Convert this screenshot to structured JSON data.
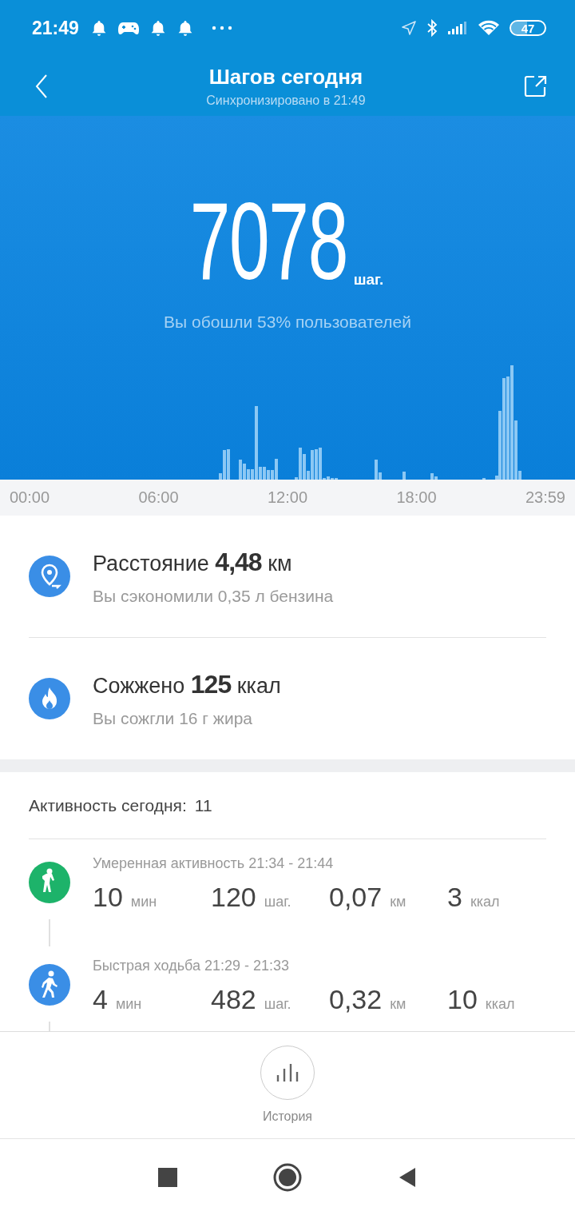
{
  "status_bar": {
    "time": "21:49",
    "battery": "47"
  },
  "header": {
    "title": "Шагов сегодня",
    "subtitle": "Синхронизировано в 21:49"
  },
  "steps": {
    "value": "7078",
    "unit": "шаг.",
    "comparison": "Вы обошли 53% пользователей"
  },
  "time_axis": [
    "00:00",
    "06:00",
    "12:00",
    "18:00",
    "23:59"
  ],
  "summary": [
    {
      "kind": "distance",
      "label": "Расстояние",
      "value": "4,48",
      "unit": "км",
      "note": "Вы сэкономили 0,35 л бензина"
    },
    {
      "kind": "calories",
      "label": "Сожжено",
      "value": "125",
      "unit": "ккал",
      "note": "Вы сожгли 16 г жира"
    }
  ],
  "activity": {
    "label": "Активность сегодня:",
    "count": "11",
    "items": [
      {
        "kind": "moderate",
        "color": "#1db36a",
        "title": "Умеренная активность 21:34 - 21:44",
        "stats": [
          {
            "value": "10",
            "unit": "мин"
          },
          {
            "value": "120",
            "unit": "шаг."
          },
          {
            "value": "0,07",
            "unit": "км"
          },
          {
            "value": "3",
            "unit": "ккал"
          }
        ]
      },
      {
        "kind": "walk",
        "color": "#3a8ee6",
        "title": "Быстрая ходьба 21:29 - 21:33",
        "stats": [
          {
            "value": "4",
            "unit": "мин"
          },
          {
            "value": "482",
            "unit": "шаг."
          },
          {
            "value": "0,32",
            "unit": "км"
          },
          {
            "value": "10",
            "unit": "ккал"
          }
        ]
      }
    ]
  },
  "bottom_nav": {
    "label": "История"
  }
}
